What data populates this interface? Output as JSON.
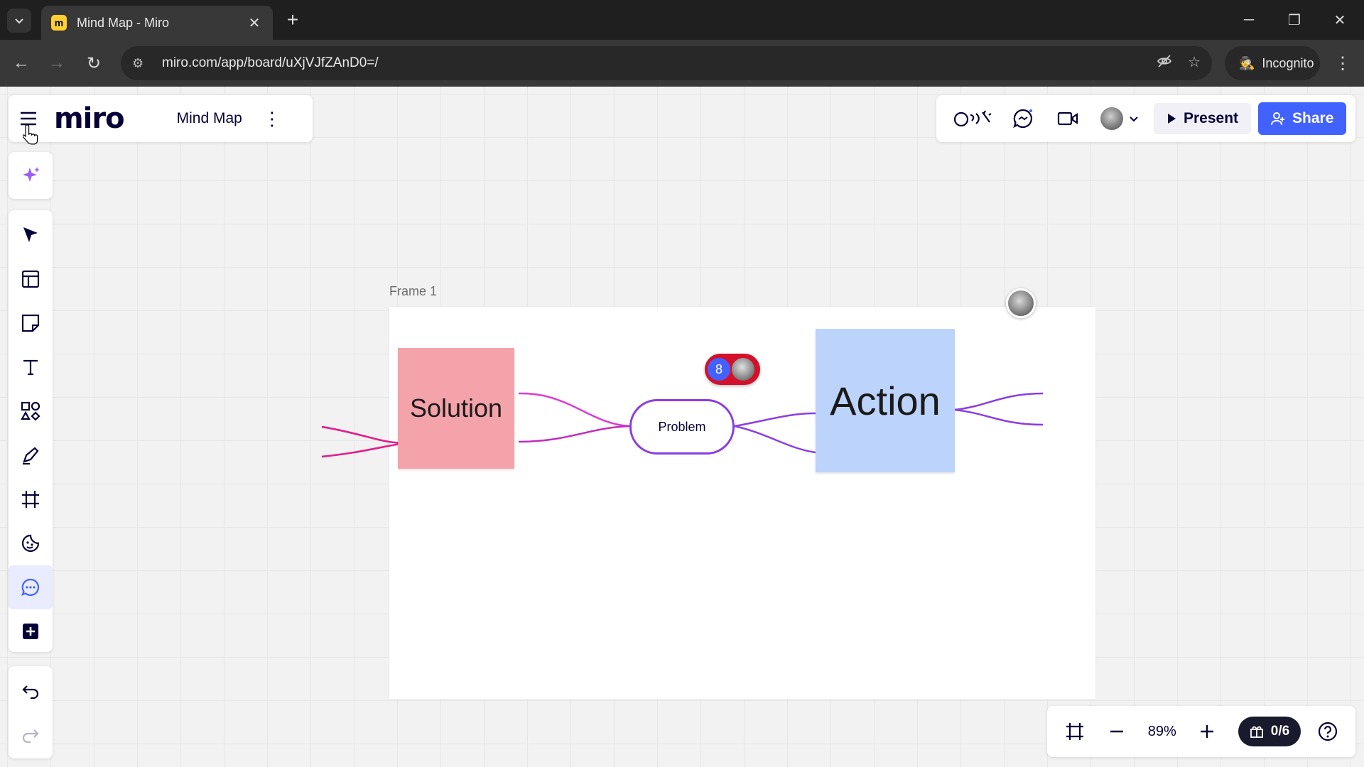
{
  "browser": {
    "tab_title": "Mind Map - Miro",
    "tab_favicon_letter": "m",
    "url": "miro.com/app/board/uXjVJfZAnD0=/",
    "incognito_label": "Incognito"
  },
  "app": {
    "logo": "miro",
    "board_name": "Mind Map",
    "present_label": "Present",
    "share_label": "Share",
    "zoom_level": "89%",
    "gift_counter": "0/6",
    "accent_color": "#4262ff"
  },
  "toolbar": {
    "tools": [
      "ai-sparkle-icon",
      "select-cursor-icon",
      "templates-icon",
      "sticky-note-icon",
      "text-icon",
      "shapes-icon",
      "pen-icon",
      "frame-icon",
      "stickers-icon",
      "comment-icon",
      "add-more-icon",
      "undo-icon",
      "redo-icon"
    ]
  },
  "board": {
    "frame_label": "Frame 1",
    "solution_text": "Solution",
    "problem_text": "Problem",
    "action_text": "Action",
    "comment_count": "8"
  }
}
